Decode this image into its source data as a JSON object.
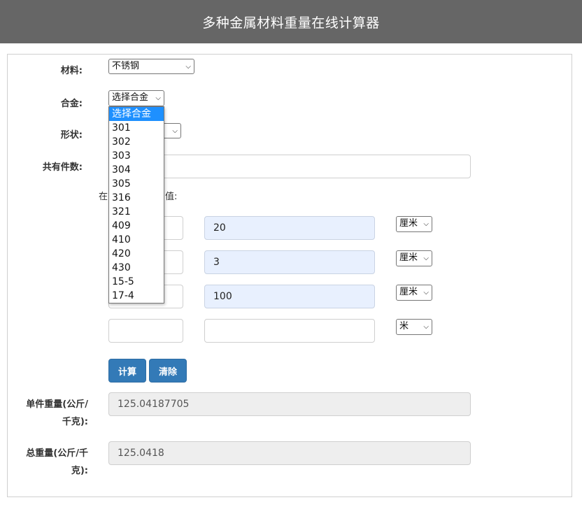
{
  "header": {
    "title": "多种金属材料重量在线计算器"
  },
  "form": {
    "material": {
      "label": "材料:",
      "value": "不锈钢"
    },
    "alloy": {
      "label": "合金:",
      "value": "选择合金",
      "options": [
        "选择合金",
        "301",
        "302",
        "303",
        "304",
        "305",
        "316",
        "321",
        "409",
        "410",
        "420",
        "430",
        "15-5",
        "17-4"
      ]
    },
    "shape": {
      "label": "形状:"
    },
    "count": {
      "label": "共有件数:",
      "value": ""
    },
    "note": "在",
    "note_tail": "值:",
    "dims": [
      {
        "left_value": "",
        "value": "20",
        "unit": "厘米"
      },
      {
        "left_value": "",
        "value": "3",
        "unit": "厘米"
      },
      {
        "left_value": "",
        "value": "100",
        "unit": "厘米"
      },
      {
        "left_value": "",
        "value": "",
        "unit": "米"
      }
    ],
    "buttons": {
      "calculate": "计算",
      "clear": "清除"
    },
    "unit_weight": {
      "label_line1": "单件重量(公斤/",
      "label_line2": "千克):",
      "value": "125.04187705"
    },
    "total_weight": {
      "label_line1": "总重量(公斤/千",
      "label_line2": "克):",
      "value": "125.0418"
    }
  }
}
